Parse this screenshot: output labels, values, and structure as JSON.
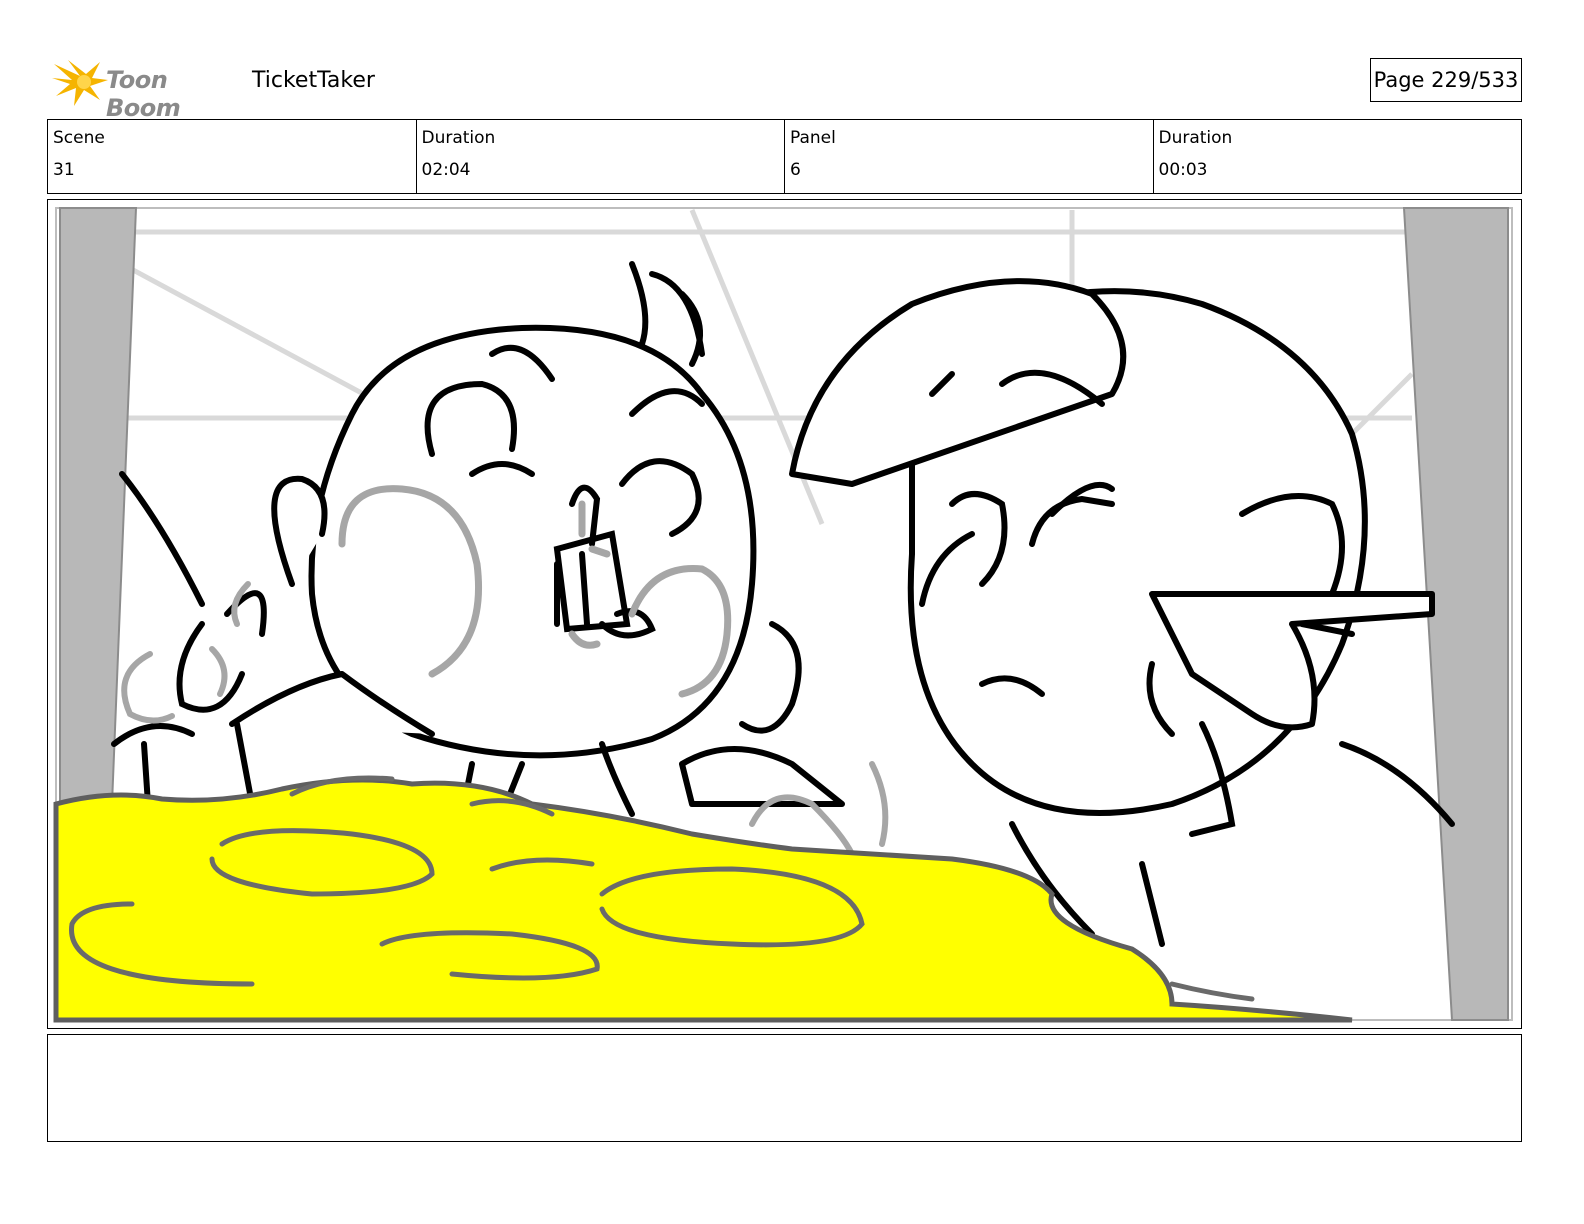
{
  "header": {
    "brand": "Toon Boom",
    "project": "TicketTaker",
    "page": "Page 229/533"
  },
  "info": [
    {
      "label": "Scene",
      "value": "31"
    },
    {
      "label": "Duration",
      "value": "02:04"
    },
    {
      "label": "Panel",
      "value": "6"
    },
    {
      "label": "Duration",
      "value": "00:03"
    }
  ],
  "notes": "",
  "colors": {
    "logo_accent": "#f5b400",
    "highlight": "#ffff00",
    "frame_gray": "#b8b8b8"
  }
}
